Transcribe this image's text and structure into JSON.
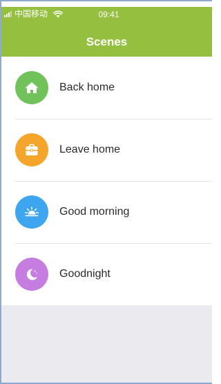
{
  "status_bar": {
    "carrier": "中国移动",
    "time": "09:41"
  },
  "header": {
    "title": "Scenes"
  },
  "scenes": [
    {
      "label": "Back home",
      "icon": "home-icon",
      "color": "#71c25a"
    },
    {
      "label": "Leave home",
      "icon": "briefcase-icon",
      "color": "#f4a52c"
    },
    {
      "label": "Good morning",
      "icon": "sunrise-icon",
      "color": "#3ea6ef"
    },
    {
      "label": "Goodnight",
      "icon": "moon-icon",
      "color": "#c57ee0"
    }
  ],
  "colors": {
    "header": "#94bf3f",
    "background": "#ebebef"
  }
}
